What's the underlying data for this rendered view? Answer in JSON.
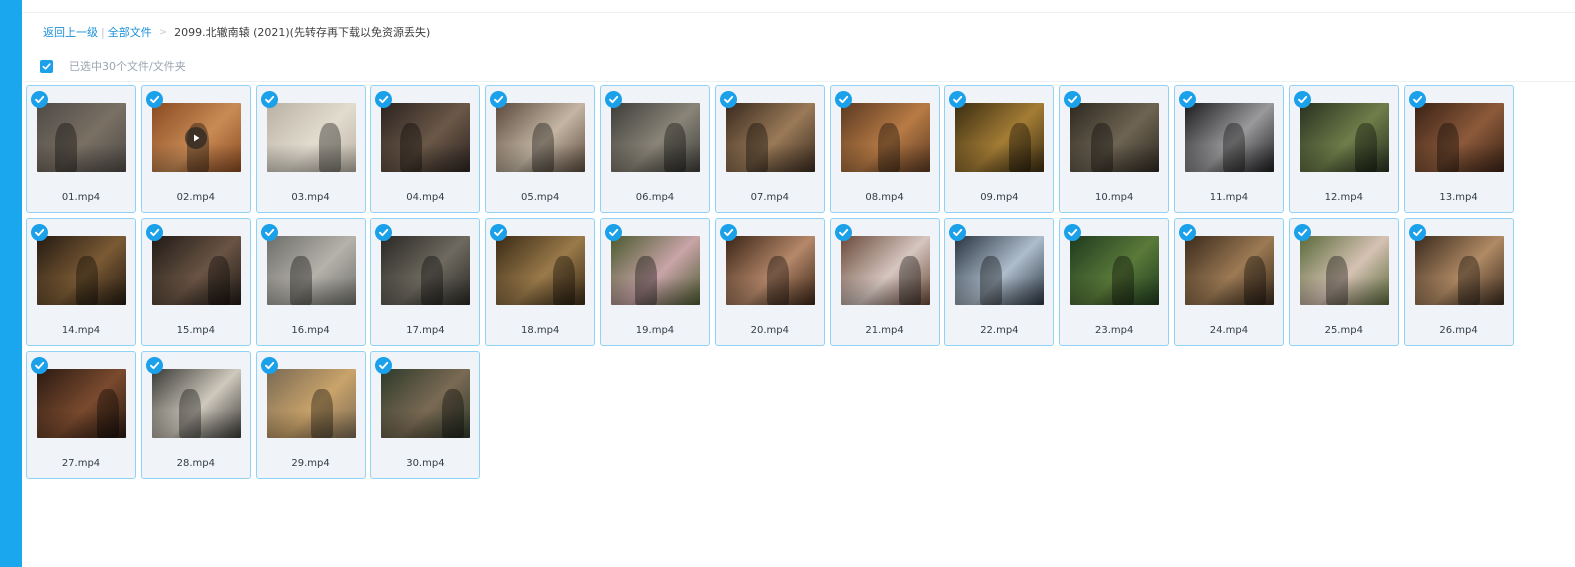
{
  "breadcrumb": {
    "back_label": "返回上一级",
    "root_label": "全部文件",
    "separator": ">",
    "current_folder": "2099.北辙南辕 (2021)(先转存再下载以免资源丢失)"
  },
  "selection": {
    "status_text": "已选中30个文件/文件夹",
    "all_checked": true
  },
  "colors": {
    "accent": "#1ba7ee",
    "tile_border": "#8fd2f5",
    "tile_bg": "#f0f4f9",
    "link": "#1a8fd8"
  },
  "files": [
    {
      "name": "01.mp4",
      "c1": "#4e4a46",
      "c2": "#7a7064",
      "playing": false
    },
    {
      "name": "02.mp4",
      "c1": "#8a4a22",
      "c2": "#c98b55",
      "playing": true
    },
    {
      "name": "03.mp4",
      "c1": "#b9b1a4",
      "c2": "#e2dccf",
      "playing": false
    },
    {
      "name": "04.mp4",
      "c1": "#2b2320",
      "c2": "#6b5848",
      "playing": false
    },
    {
      "name": "05.mp4",
      "c1": "#5b4a3e",
      "c2": "#c4b6a3",
      "playing": false
    },
    {
      "name": "06.mp4",
      "c1": "#3e3d3a",
      "c2": "#8a8578",
      "playing": false
    },
    {
      "name": "07.mp4",
      "c1": "#3a2a1f",
      "c2": "#9a7a58",
      "playing": false
    },
    {
      "name": "08.mp4",
      "c1": "#5b3a22",
      "c2": "#b87b45",
      "playing": false
    },
    {
      "name": "09.mp4",
      "c1": "#3a2c12",
      "c2": "#a47d35",
      "playing": false
    },
    {
      "name": "10.mp4",
      "c1": "#2e2820",
      "c2": "#6e6453",
      "playing": false
    },
    {
      "name": "11.mp4",
      "c1": "#1c1c1e",
      "c2": "#9a9a9c",
      "playing": false
    },
    {
      "name": "12.mp4",
      "c1": "#283020",
      "c2": "#6f7e4a",
      "playing": false
    },
    {
      "name": "13.mp4",
      "c1": "#3a2216",
      "c2": "#8c5a3a",
      "playing": false
    },
    {
      "name": "14.mp4",
      "c1": "#241a12",
      "c2": "#7a5a34",
      "playing": false
    },
    {
      "name": "15.mp4",
      "c1": "#201a16",
      "c2": "#6a5444",
      "playing": false
    },
    {
      "name": "16.mp4",
      "c1": "#6e6e6a",
      "c2": "#b5b2aa",
      "playing": false
    },
    {
      "name": "17.mp4",
      "c1": "#2a2824",
      "c2": "#6e6a60",
      "playing": false
    },
    {
      "name": "18.mp4",
      "c1": "#3a2a16",
      "c2": "#9a7a4a",
      "playing": false
    },
    {
      "name": "19.mp4",
      "c1": "#4a5a2e",
      "c2": "#c9a4a8",
      "playing": false
    },
    {
      "name": "20.mp4",
      "c1": "#3a2416",
      "c2": "#b5886a",
      "playing": false
    },
    {
      "name": "21.mp4",
      "c1": "#6a4a3a",
      "c2": "#d6c6c0",
      "playing": false
    },
    {
      "name": "22.mp4",
      "c1": "#2a3440",
      "c2": "#aebdcc",
      "playing": false
    },
    {
      "name": "23.mp4",
      "c1": "#1e3a1e",
      "c2": "#5a7a3a",
      "playing": false
    },
    {
      "name": "24.mp4",
      "c1": "#3a2a1c",
      "c2": "#9c7a54",
      "playing": false
    },
    {
      "name": "25.mp4",
      "c1": "#5a6a3a",
      "c2": "#d6c2b4",
      "playing": false
    },
    {
      "name": "26.mp4",
      "c1": "#3a2a1e",
      "c2": "#b08a64",
      "playing": false
    },
    {
      "name": "27.mp4",
      "c1": "#2a1a12",
      "c2": "#7a4a2e",
      "playing": false
    },
    {
      "name": "28.mp4",
      "c1": "#3a3a36",
      "c2": "#cfc9bd",
      "playing": false
    },
    {
      "name": "29.mp4",
      "c1": "#7a6a54",
      "c2": "#c9a36a",
      "playing": false
    },
    {
      "name": "30.mp4",
      "c1": "#2e3a2a",
      "c2": "#7a6a54",
      "playing": false
    }
  ]
}
